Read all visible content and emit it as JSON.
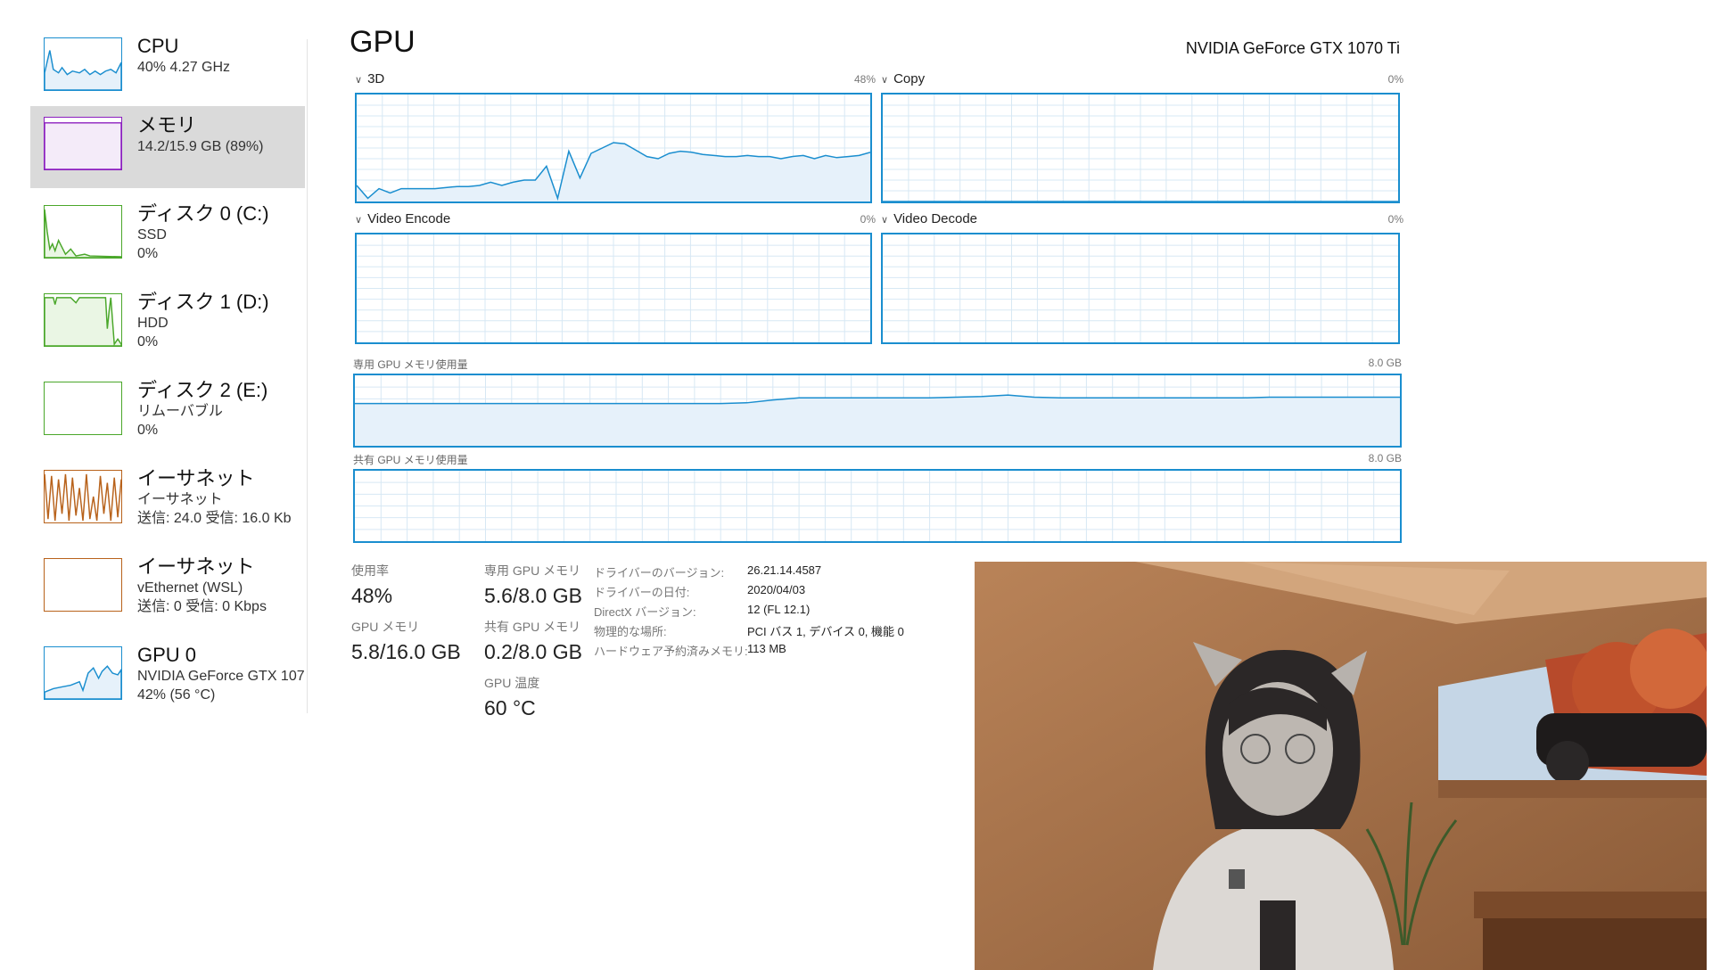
{
  "sidebar": {
    "items": [
      {
        "title": "CPU",
        "sub1": "40%  4.27 GHz",
        "sub2": "",
        "color": "#1a8ecf"
      },
      {
        "title": "メモリ",
        "sub1": "14.2/15.9 GB (89%)",
        "sub2": "",
        "color": "#8b1fbf"
      },
      {
        "title": "ディスク 0 (C:)",
        "sub1": "SSD",
        "sub2": "0%",
        "color": "#4aa72a"
      },
      {
        "title": "ディスク 1 (D:)",
        "sub1": "HDD",
        "sub2": "0%",
        "color": "#4aa72a"
      },
      {
        "title": "ディスク 2 (E:)",
        "sub1": "リムーバブル",
        "sub2": "0%",
        "color": "#4aa72a"
      },
      {
        "title": "イーサネット",
        "sub1": "イーサネット",
        "sub2": "送信: 24.0 受信: 16.0 Kb",
        "color": "#b8621b"
      },
      {
        "title": "イーサネット",
        "sub1": "vEthernet (WSL)",
        "sub2": "送信: 0 受信: 0 Kbps",
        "color": "#b8621b"
      },
      {
        "title": "GPU 0",
        "sub1": "NVIDIA GeForce GTX 107",
        "sub2": "42% (56 °C)",
        "color": "#1a8ecf"
      }
    ]
  },
  "header": {
    "title": "GPU",
    "model": "NVIDIA GeForce GTX 1070 Ti"
  },
  "engines": [
    {
      "label": "3D",
      "pct": "48%"
    },
    {
      "label": "Copy",
      "pct": "0%"
    },
    {
      "label": "Video Encode",
      "pct": "0%"
    },
    {
      "label": "Video Decode",
      "pct": "0%"
    }
  ],
  "memory_graphs": [
    {
      "label": "専用 GPU メモリ使用量",
      "max": "8.0 GB"
    },
    {
      "label": "共有 GPU メモリ使用量",
      "max": "8.0 GB"
    }
  ],
  "stats": {
    "usage_label": "使用率",
    "usage_value": "48%",
    "dedicated_label": "専用 GPU メモリ",
    "dedicated_value": "5.6/8.0 GB",
    "gpu_mem_label": "GPU メモリ",
    "gpu_mem_value": "5.8/16.0 GB",
    "shared_label": "共有 GPU メモリ",
    "shared_value": "0.2/8.0 GB",
    "temp_label": "GPU 温度",
    "temp_value": "60 °C"
  },
  "info": [
    {
      "key": "ドライバーのバージョン:",
      "value": "26.21.14.4587"
    },
    {
      "key": "ドライバーの日付:",
      "value": "2020/04/03"
    },
    {
      "key": "DirectX バージョン:",
      "value": "12 (FL 12.1)"
    },
    {
      "key": "物理的な場所:",
      "value": "PCI バス 1, デバイス 0, 機能 0"
    },
    {
      "key": "ハードウェア予約済みメモリ:",
      "value": "113 MB"
    }
  ],
  "colors": {
    "gpu_accent": "#1a8ecf",
    "grid": "#d7e8f4",
    "fill": "#e6f1fa"
  },
  "usage_history": {
    "3d_percent": [
      15,
      3,
      12,
      8,
      12,
      12,
      12,
      12,
      13,
      14,
      14,
      15,
      18,
      15,
      18,
      20,
      20,
      33,
      3,
      47,
      22,
      45,
      50,
      55,
      54,
      48,
      42,
      40,
      45,
      47,
      46,
      44,
      43,
      42,
      42,
      43,
      42,
      42,
      40,
      42,
      43,
      40,
      43,
      41,
      42,
      43,
      46
    ],
    "dedicated_fraction": [
      0.6,
      0.6,
      0.6,
      0.6,
      0.6,
      0.6,
      0.6,
      0.6,
      0.6,
      0.6,
      0.6,
      0.6,
      0.6,
      0.6,
      0.6,
      0.61,
      0.65,
      0.68,
      0.68,
      0.68,
      0.68,
      0.68,
      0.68,
      0.69,
      0.7,
      0.72,
      0.69,
      0.68,
      0.68,
      0.68,
      0.68,
      0.68,
      0.68,
      0.68,
      0.68,
      0.69,
      0.69,
      0.69,
      0.69,
      0.69,
      0.69
    ]
  }
}
